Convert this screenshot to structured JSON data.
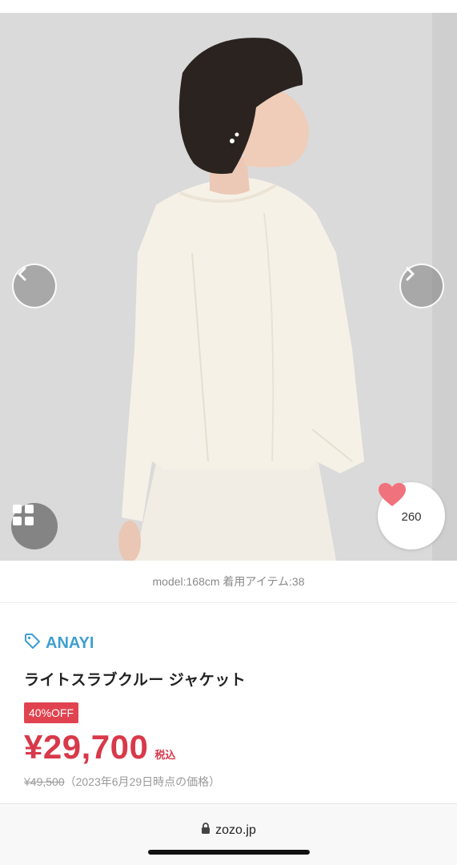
{
  "gallery": {
    "prev_icon": "chevron-left-icon",
    "next_icon": "chevron-right-icon",
    "grid_icon": "grid-icon",
    "favorite": {
      "icon": "heart-icon",
      "count": "260",
      "color": "#f0727d"
    }
  },
  "caption": "model:168cm 着用アイテム:38",
  "product": {
    "brand": "ANAYI",
    "brand_icon": "tag-icon",
    "name": "ライトスラブクルー ジャケット",
    "discount_badge": "40%OFF",
    "price": "¥29,700",
    "tax_label": "税込",
    "original_price": "¥49,500",
    "original_price_note": "（2023年6月29日時点の価格）"
  },
  "browser": {
    "lock_icon": "lock-icon",
    "url": "zozo.jp"
  },
  "colors": {
    "brand": "#3f9fd1",
    "sale": "#d8394a",
    "badge": "#e0434f"
  }
}
